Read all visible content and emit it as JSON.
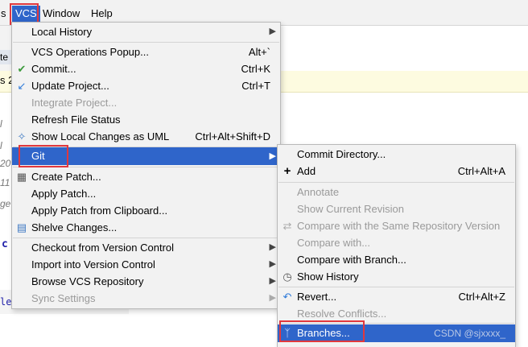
{
  "menubar": {
    "partial_left": "s",
    "vcs": "VCS",
    "window": "Window",
    "help": "Help"
  },
  "background": {
    "tab_text": "te",
    "yellow_text": "s 2",
    "gutter": [
      "l",
      "l",
      "20",
      "11",
      "ge"
    ],
    "code_c": "c",
    "code_line": "le"
  },
  "vcs_menu": {
    "items": [
      {
        "label": "Local History",
        "shortcut": "",
        "submenu": true,
        "disabled": false,
        "icon": ""
      },
      {
        "label": "VCS Operations Popup...",
        "shortcut": "Alt+`",
        "submenu": false,
        "disabled": false,
        "icon": ""
      },
      {
        "label": "Commit...",
        "shortcut": "Ctrl+K",
        "submenu": false,
        "disabled": false,
        "icon": "check-icon"
      },
      {
        "label": "Update Project...",
        "shortcut": "Ctrl+T",
        "submenu": false,
        "disabled": false,
        "icon": "update-arrow-icon"
      },
      {
        "label": "Integrate Project...",
        "shortcut": "",
        "submenu": false,
        "disabled": true,
        "icon": ""
      },
      {
        "label": "Refresh File Status",
        "shortcut": "",
        "submenu": false,
        "disabled": false,
        "icon": ""
      },
      {
        "label": "Show Local Changes as UML",
        "shortcut": "Ctrl+Alt+Shift+D",
        "submenu": false,
        "disabled": false,
        "icon": "uml-icon"
      },
      {
        "label": "Git",
        "shortcut": "",
        "submenu": true,
        "disabled": false,
        "icon": ""
      },
      {
        "label": "Create Patch...",
        "shortcut": "",
        "submenu": false,
        "disabled": false,
        "icon": "patch-icon"
      },
      {
        "label": "Apply Patch...",
        "shortcut": "",
        "submenu": false,
        "disabled": false,
        "icon": ""
      },
      {
        "label": "Apply Patch from Clipboard...",
        "shortcut": "",
        "submenu": false,
        "disabled": false,
        "icon": ""
      },
      {
        "label": "Shelve Changes...",
        "shortcut": "",
        "submenu": false,
        "disabled": false,
        "icon": "shelve-icon"
      },
      {
        "label": "Checkout from Version Control",
        "shortcut": "",
        "submenu": true,
        "disabled": false,
        "icon": ""
      },
      {
        "label": "Import into Version Control",
        "shortcut": "",
        "submenu": true,
        "disabled": false,
        "icon": ""
      },
      {
        "label": "Browse VCS Repository",
        "shortcut": "",
        "submenu": true,
        "disabled": false,
        "icon": ""
      },
      {
        "label": "Sync Settings",
        "shortcut": "",
        "submenu": true,
        "disabled": true,
        "icon": ""
      }
    ]
  },
  "git_menu": {
    "items": [
      {
        "label": "Commit Directory...",
        "shortcut": "",
        "disabled": false,
        "icon": ""
      },
      {
        "label": "Add",
        "shortcut": "Ctrl+Alt+A",
        "disabled": false,
        "icon": "plus-icon"
      },
      {
        "label": "Annotate",
        "shortcut": "",
        "disabled": true,
        "icon": ""
      },
      {
        "label": "Show Current Revision",
        "shortcut": "",
        "disabled": true,
        "icon": ""
      },
      {
        "label": "Compare with the Same Repository Version",
        "shortcut": "",
        "disabled": true,
        "icon": "compare-icon"
      },
      {
        "label": "Compare with...",
        "shortcut": "",
        "disabled": true,
        "icon": ""
      },
      {
        "label": "Compare with Branch...",
        "shortcut": "",
        "disabled": false,
        "icon": ""
      },
      {
        "label": "Show History",
        "shortcut": "",
        "disabled": false,
        "icon": "history-icon"
      },
      {
        "label": "Revert...",
        "shortcut": "Ctrl+Alt+Z",
        "disabled": false,
        "icon": "revert-icon"
      },
      {
        "label": "Resolve Conflicts...",
        "shortcut": "",
        "disabled": true,
        "icon": ""
      },
      {
        "label": "Branches...",
        "shortcut": "",
        "disabled": false,
        "icon": "branch-icon"
      }
    ],
    "watermark": "CSDN @sjxxxx_"
  }
}
